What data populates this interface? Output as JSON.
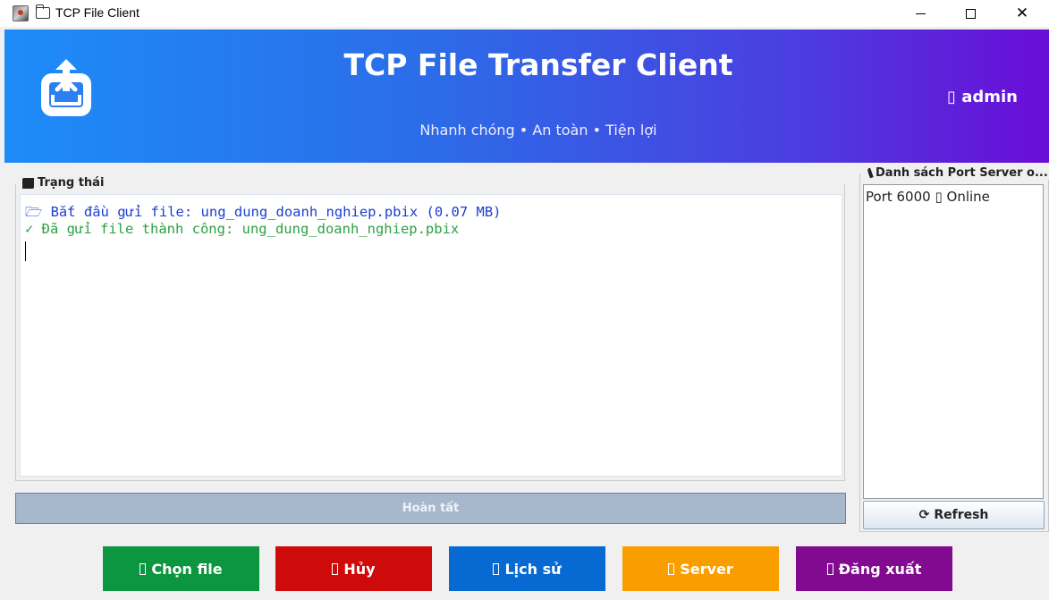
{
  "window": {
    "title": "TCP File Client"
  },
  "header": {
    "title": "TCP File Transfer Client",
    "subtitle": "Nhanh chóng • An toàn • Tiện lợi",
    "user": "admin"
  },
  "status": {
    "legend": "Trạng thái",
    "lines": [
      "Bắt đầu gửi file: ung_dung_doanh_nghiep.pbix (0.07 MB)",
      "Đã gửi file thành công: ung_dung_doanh_nghiep.pbix"
    ]
  },
  "progress": {
    "label": "Hoàn tất",
    "percent": 100
  },
  "ports": {
    "legend": "Danh sách Port Server o...",
    "items": [
      {
        "port": "Port 6000",
        "status": "Online"
      }
    ],
    "refresh_label": "Refresh"
  },
  "actions": {
    "choose_file": "Chọn file",
    "cancel": "Hủy",
    "history": "Lịch sử",
    "server": "Server",
    "logout": "Đăng xuất"
  },
  "colors": {
    "choose_file": "#0c963f",
    "cancel": "#cf0a0a",
    "history": "#0769d2",
    "server": "#fa9e00",
    "logout": "#820a91",
    "header_gradient_start": "#1d8cf8",
    "header_gradient_end": "#6a0dd6"
  },
  "icons": {
    "app": "java-app-icon",
    "folder": "folder-icon",
    "logo": "upload-inbox-icon",
    "user": "user-icon",
    "status": "scroll-icon",
    "log_start": "open-folder-icon",
    "log_success": "check-icon",
    "ports": "satellite-icon",
    "refresh": "refresh-icon"
  }
}
